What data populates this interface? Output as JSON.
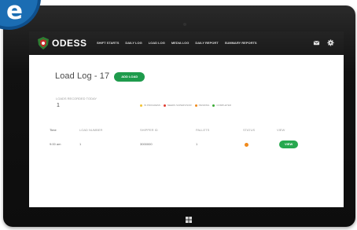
{
  "badge": {
    "letter": "e",
    "color": "#1b6db3"
  },
  "navbar": {
    "brand": "ODESS",
    "logo_icon": "shield-logo-icon",
    "items": [
      {
        "label": "SHIFT STARTS"
      },
      {
        "label": "DAILY LOG"
      },
      {
        "label": "LOAD LOG"
      },
      {
        "label": "MEDIA LOG"
      },
      {
        "label": "DAILY REPORT"
      },
      {
        "label": "SUMMARY REPORTS"
      }
    ],
    "icons": [
      "mail-icon",
      "gear-icon"
    ]
  },
  "page": {
    "title": "Load Log - 17",
    "add_button_label": "ADD LOAD"
  },
  "summary": {
    "label": "LOADS RECORDED TODAY",
    "value": "1"
  },
  "legend": [
    {
      "label": "IN PROGRESS",
      "color": "#f1c232"
    },
    {
      "label": "NEEDS SUPERVISOR",
      "color": "#e03b2f"
    },
    {
      "label": "PENDING",
      "color": "#f08a1c"
    },
    {
      "label": "COMPLETED",
      "color": "#3aaa35"
    }
  ],
  "table": {
    "headers": [
      "Time",
      "LOAD NUMBER",
      "SHIPPER ID",
      "PALLETS",
      "STATUS",
      "VIEW"
    ],
    "rows": [
      {
        "time": "9:00 am",
        "load_number": "1",
        "shipper": "3000000",
        "pallets": "1",
        "status": "pending",
        "action_label": "VIEW"
      }
    ]
  },
  "colors": {
    "navbar": "#1a1a1a",
    "accent_green": "#1e9b4c",
    "status_pending": "#f08a1c"
  },
  "device": {
    "home_icon": "windows-logo-icon"
  }
}
